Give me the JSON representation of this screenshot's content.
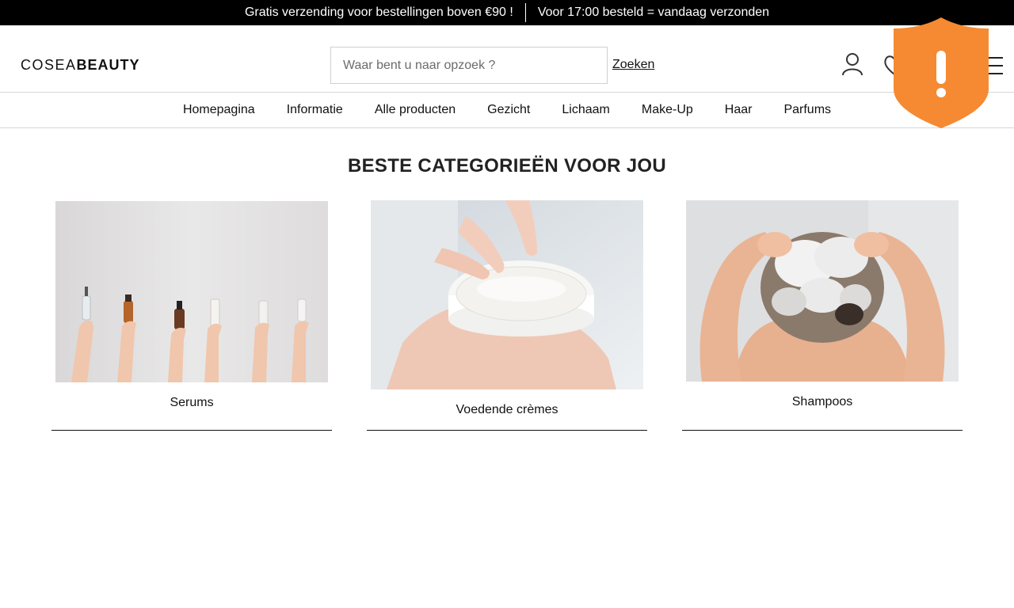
{
  "announcement": {
    "left": "Gratis verzending voor bestellingen boven €90 !",
    "right": "Voor 17:00 besteld = vandaag verzonden"
  },
  "header": {
    "logo_thin": "COSEA",
    "logo_bold": "BEAUTY",
    "search_placeholder": "Waar bent u naar opzoek ?",
    "search_value": "",
    "search_button": "Zoeken",
    "icons": [
      "user-icon",
      "heart-icon",
      "menu-icon"
    ]
  },
  "nav": {
    "items": [
      "Homepagina",
      "Informatie",
      "Alle producten",
      "Gezicht",
      "Lichaam",
      "Make-Up",
      "Haar",
      "Parfums"
    ]
  },
  "overlay": {
    "icon": "security-warning-shield-icon",
    "color": "#F58A32"
  },
  "main": {
    "title": "BESTE CATEGORIEËN VOOR JOU",
    "categories": [
      {
        "label": "Serums",
        "image": "hands holding serum bottles"
      },
      {
        "label": "Voedende crèmes",
        "image": "hands holding cream jar"
      },
      {
        "label": "Shampoos",
        "image": "woman washing hair"
      }
    ]
  },
  "colors": {
    "topbar_bg": "#000000",
    "text": "#111111",
    "border": "#D6D6D6"
  }
}
